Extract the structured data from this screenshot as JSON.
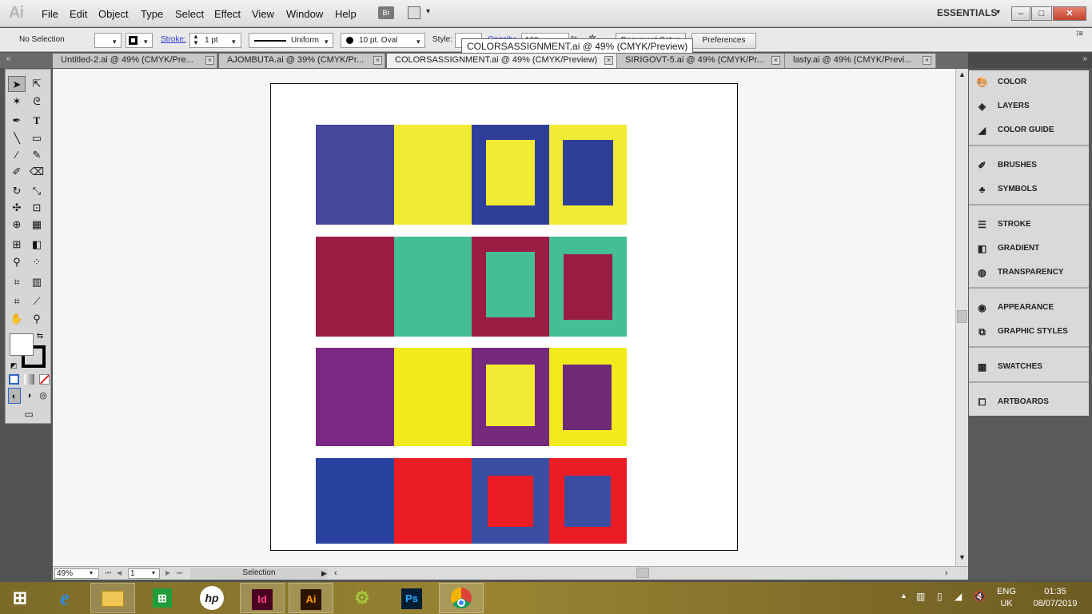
{
  "menubar": {
    "logo": "Ai",
    "items": [
      "File",
      "Edit",
      "Object",
      "Type",
      "Select",
      "Effect",
      "View",
      "Window",
      "Help"
    ],
    "bridge": "Br",
    "workspace": "ESSENTIALS",
    "win_min": "–",
    "win_max": "□",
    "win_close": "✕"
  },
  "control": {
    "selection": "No Selection",
    "stroke_label": "Stroke:",
    "stroke_weight": "1 pt",
    "profile": "Uniform",
    "brush": "10 pt. Oval",
    "style_label": "Style:",
    "opacity_label": "Opacity:",
    "opacity_value": "100",
    "percent": "%",
    "doc_setup": "Document Setup",
    "preferences": "Preferences"
  },
  "tooltip": "COLORSASSIGNMENT.ai @ 49% (CMYK/Preview)",
  "tabs": [
    {
      "label": "Untitled-2.ai @ 49% (CMYK/Pre..."
    },
    {
      "label": "AJOMBUTA.ai @ 39% (CMYK/Pr..."
    },
    {
      "label": "COLORSASSIGNMENT.ai @ 49% (CMYK/Preview)"
    },
    {
      "label": "SIRIGOVT-5.ai @ 49% (CMYK/Pr..."
    },
    {
      "label": "lasty.ai @ 49% (CMYK/Previ..."
    }
  ],
  "status": {
    "zoom": "49%",
    "page": "1",
    "tool": "Selection"
  },
  "panels": [
    {
      "label": "COLOR",
      "icon": "color-icon"
    },
    {
      "label": "LAYERS",
      "icon": "layers-icon"
    },
    {
      "label": "COLOR GUIDE",
      "icon": "color-guide-icon"
    },
    {
      "label": "BRUSHES",
      "icon": "brushes-icon"
    },
    {
      "label": "SYMBOLS",
      "icon": "symbols-icon"
    },
    {
      "label": "STROKE",
      "icon": "stroke-icon"
    },
    {
      "label": "GRADIENT",
      "icon": "gradient-icon"
    },
    {
      "label": "TRANSPARENCY",
      "icon": "transparency-icon"
    },
    {
      "label": "APPEARANCE",
      "icon": "appearance-icon"
    },
    {
      "label": "GRAPHIC STYLES",
      "icon": "graphic-styles-icon"
    },
    {
      "label": "SWATCHES",
      "icon": "swatches-icon"
    },
    {
      "label": "ARTBOARDS",
      "icon": "artboards-icon"
    }
  ],
  "artwork": {
    "rows": [
      {
        "a": "#45469c",
        "b": "#f2eb33",
        "c": "#2e3f99",
        "c_inner": "#f2eb33",
        "d": "#f2eb33",
        "d_inner": "#2e3f99"
      },
      {
        "a": "#9b1c42",
        "b": "#45bd95",
        "c": "#9b1c42",
        "c_inner": "#45bd95",
        "d": "#45bd95",
        "d_inner": "#9b1c42"
      },
      {
        "a": "#7a2883",
        "b": "#f2ea1c",
        "c": "#762a7e",
        "c_inner": "#f2eb33",
        "d": "#f2ea1c",
        "d_inner": "#6e2a76"
      },
      {
        "a": "#2942a0",
        "b": "#ec1c24",
        "c": "#3a4ea1",
        "c_inner": "#ec1c24",
        "d": "#ec1c24",
        "d_inner": "#3a4ea1"
      }
    ]
  },
  "taskbar": {
    "apps": [
      "start-icon",
      "internet-explorer-icon",
      "file-explorer-icon",
      "store-icon",
      "hp-icon",
      "indesign-icon",
      "illustrator-icon",
      "android-studio-icon",
      "photoshop-icon",
      "chrome-icon"
    ],
    "lang_1": "ENG",
    "lang_2": "UK",
    "time": "01:35",
    "date": "08/07/2019"
  }
}
